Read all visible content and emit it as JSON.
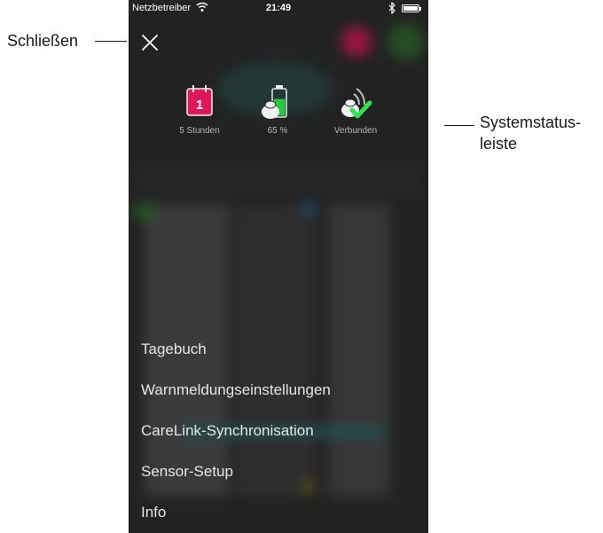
{
  "callouts": {
    "close_label": "Schließen",
    "status_label_line1": "Systemstatus-",
    "status_label_line2": "leiste"
  },
  "statusbar": {
    "carrier": "Netzbetreiber",
    "time": "21:49"
  },
  "status_items": [
    {
      "label": "5 Stunden",
      "icon": "calendar-icon",
      "badge": "1"
    },
    {
      "label": "65 %",
      "icon": "battery-icon"
    },
    {
      "label": "Verbunden",
      "icon": "connection-icon"
    }
  ],
  "menu": {
    "items": [
      "Tagebuch",
      "Warnmeldungseinstellungen",
      "CareLink-Synchronisation",
      "Sensor-Setup",
      "Info"
    ]
  },
  "colors": {
    "accent_red": "#e0185a",
    "accent_green": "#27c940",
    "check_green": "#2ee34f"
  },
  "battery_level": 0.65
}
